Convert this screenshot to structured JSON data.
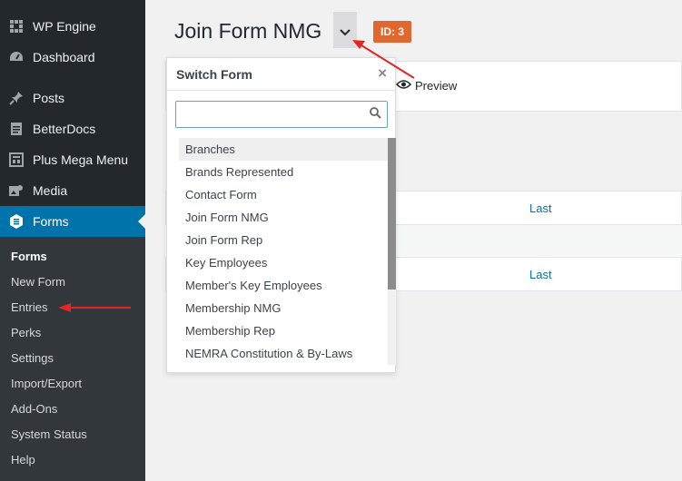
{
  "sidebar": {
    "items": [
      {
        "label": "WP Engine",
        "icon": "wp-engine-icon"
      },
      {
        "label": "Dashboard",
        "icon": "dashboard-icon"
      },
      {
        "label": "Posts",
        "icon": "pin-icon"
      },
      {
        "label": "BetterDocs",
        "icon": "docs-icon"
      },
      {
        "label": "Plus Mega Menu",
        "icon": "mega-menu-icon"
      },
      {
        "label": "Media",
        "icon": "media-icon"
      },
      {
        "label": "Forms",
        "icon": "forms-icon"
      }
    ],
    "submenu": [
      "Forms",
      "New Form",
      "Entries",
      "Perks",
      "Settings",
      "Import/Export",
      "Add-Ons",
      "System Status",
      "Help"
    ]
  },
  "header": {
    "title": "Join Form NMG",
    "id_badge": "ID: 3"
  },
  "toolbar": {
    "preview_label": "Preview"
  },
  "table": {
    "links": [
      "Last",
      "Last"
    ]
  },
  "switcher": {
    "title": "Switch Form",
    "close": "×",
    "search_placeholder": "",
    "items": [
      "Branches",
      "Brands Represented",
      "Contact Form",
      "Join Form NMG",
      "Join Form Rep",
      "Key Employees",
      "Member's Key Employees",
      "Membership NMG",
      "Membership Rep",
      "NEMRA Constitution & By-Laws"
    ]
  },
  "colors": {
    "sidebar_bg": "#23282d",
    "active": "#0073aa",
    "badge": "#e0682e",
    "arrow": "#e32525"
  }
}
